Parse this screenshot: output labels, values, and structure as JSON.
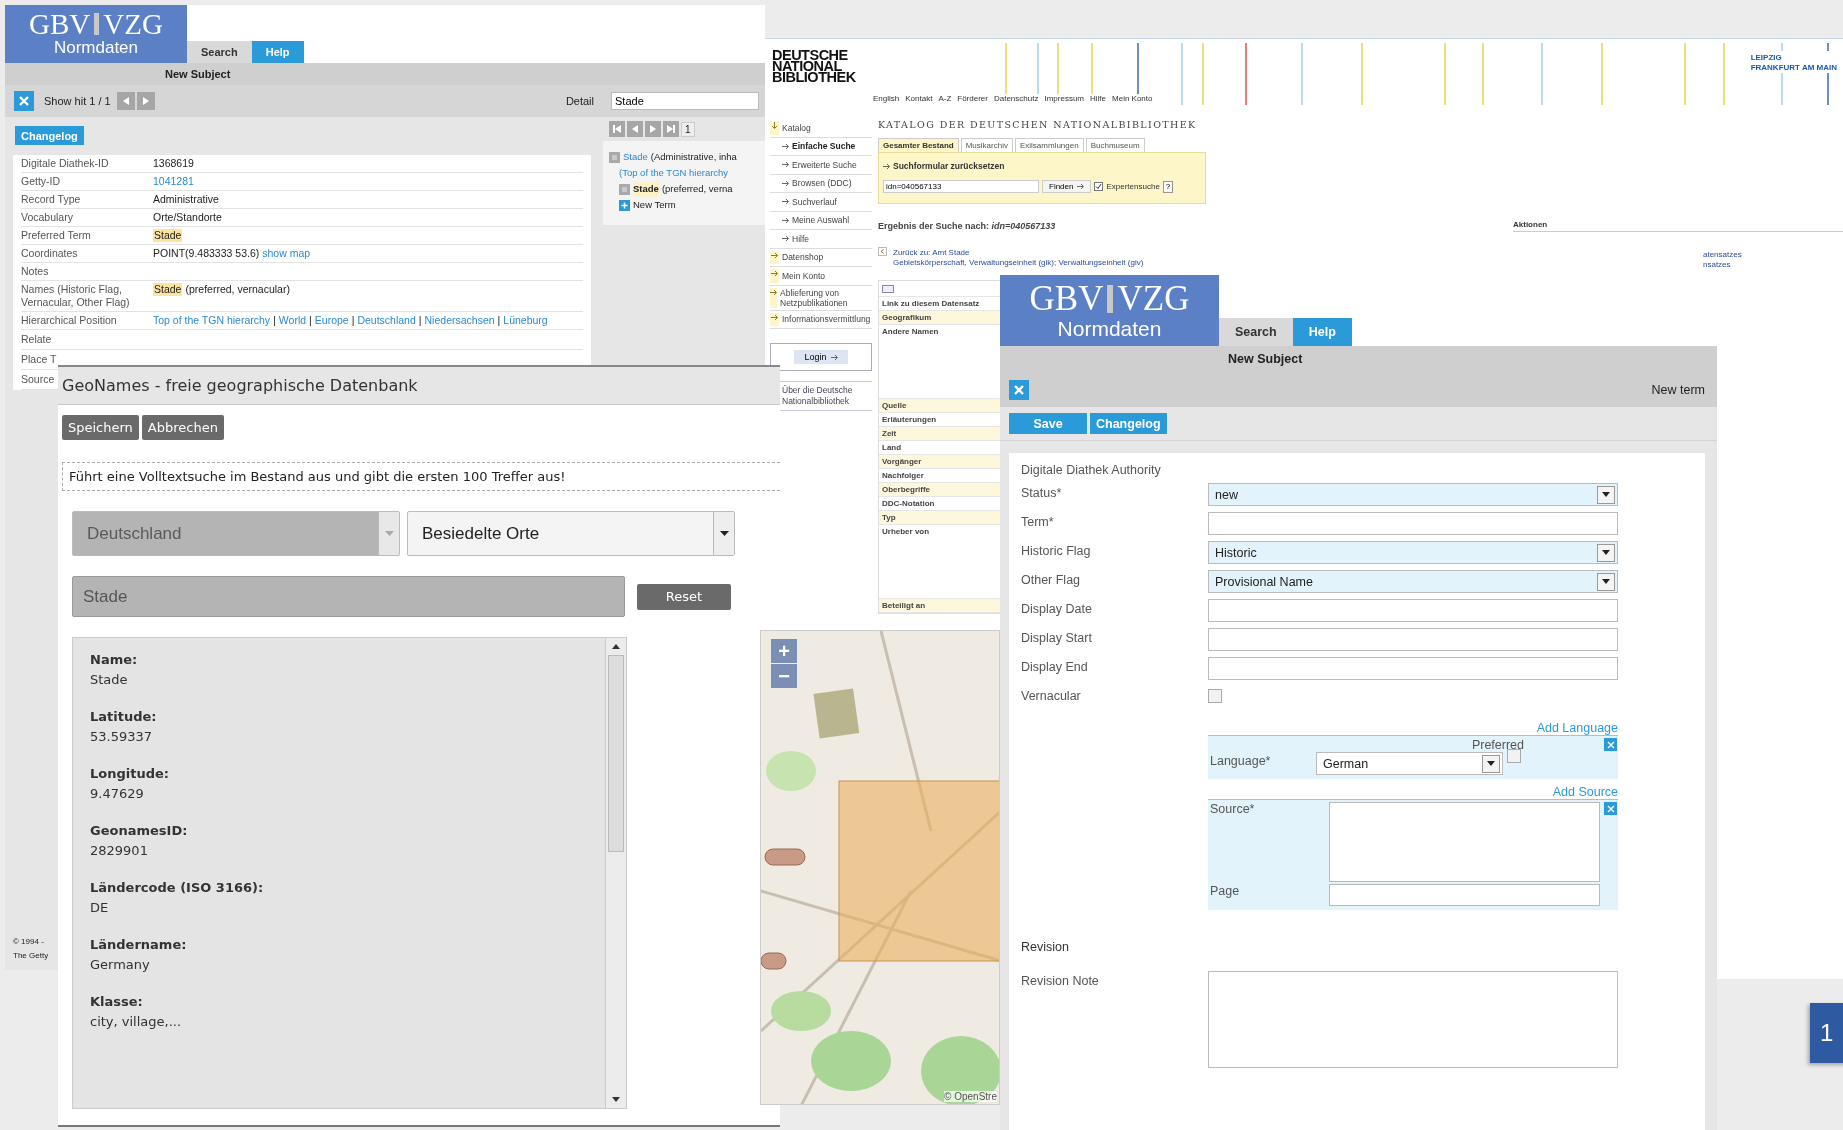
{
  "detail_window": {
    "logo": {
      "left": "GBV",
      "right": "VZG",
      "subtitle": "Normdaten"
    },
    "tabs": [
      {
        "label": "Search",
        "selected": false
      },
      {
        "label": "Help",
        "selected": true
      }
    ],
    "subheading": "New Subject",
    "hit_label": "Show hit 1 / 1",
    "view_label": "Detail",
    "changelog_button": "Changelog",
    "fields": [
      {
        "label": "Digitale Diathek-ID",
        "kind": "text",
        "value": "1368619"
      },
      {
        "label": "Getty-ID",
        "kind": "link",
        "value": "1041281"
      },
      {
        "label": "Record Type",
        "kind": "text",
        "value": "Administrative"
      },
      {
        "label": "Vocabulary",
        "kind": "text",
        "value": "Orte/Standorte"
      },
      {
        "label": "Preferred Term",
        "kind": "highlight",
        "value": "Stade"
      },
      {
        "label": "Coordinates",
        "kind": "point",
        "value": "POINT(9.483333 53.6)",
        "link": "show map"
      },
      {
        "label": "Notes",
        "kind": "text"
      },
      {
        "label": "Names (Historic Flag, Vernacular, Other Flag)",
        "kind": "highlight",
        "value": "Stade",
        "note": "(preferred, vernacular)"
      },
      {
        "label": "Hierarchical Position",
        "kind": "links",
        "separator": "|",
        "links": [
          "Top of the TGN hierarchy",
          "World",
          "Europe",
          "Deutschland",
          "Niedersachsen",
          "Lüneburg"
        ]
      }
    ],
    "covered_rows": [
      "Relate",
      "Place T",
      "Source"
    ],
    "footer": [
      "© 1994 -",
      "The Getty"
    ],
    "search_panel": {
      "query": "Stade",
      "page": "1",
      "tree": [
        {
          "kind": "link_entry",
          "term": "Stade",
          "text": "(Administrative, inha",
          "path": "(Top of the TGN hierarchy",
          "children": [
            {
              "kind": "term_entry",
              "term": "Stade",
              "text": "(preferred, verna"
            },
            {
              "kind": "new",
              "text": "New Term"
            }
          ]
        }
      ]
    }
  },
  "catalog_window": {
    "logo": [
      "DEUTSCHE",
      "NATIONAL",
      "BIBLIOTHEK"
    ],
    "nav": [
      "English",
      "Kontakt",
      "A-Z",
      "Förderer",
      "Datenschutz",
      "Impressum",
      "Hilfe",
      "Mein Konto"
    ],
    "locations": [
      "LEIPZIG",
      "FRANKFURT AM MAIN"
    ],
    "sidebar": [
      {
        "label": "Katalog",
        "expanded": true,
        "children": [
          {
            "label": "Einfache Suche",
            "selected": true
          },
          {
            "label": "Erweiterte Suche",
            "selected": false
          },
          {
            "label": "Browsen (DDC)",
            "selected": false
          },
          {
            "label": "Suchverlauf",
            "selected": false
          },
          {
            "label": "Meine Auswahl",
            "selected": false
          },
          {
            "label": "Hilfe",
            "selected": false
          }
        ]
      },
      {
        "label": "Datenshop",
        "expanded": false
      },
      {
        "label": "Mein Konto",
        "expanded": false
      },
      {
        "label": "Ablieferung von Netzpublikationen",
        "expanded": false
      },
      {
        "label": "Informationsvermittlung",
        "expanded": false
      }
    ],
    "login_button": "Login",
    "about_link": "Über die Deutsche Nationalbibliothek",
    "title": "KATALOG DER DEUTSCHEN NATIONALBIBLIOTHEK",
    "tabs": [
      {
        "label": "Gesamter Bestand",
        "selected": true
      },
      {
        "label": "Musikarchiv",
        "selected": false
      },
      {
        "label": "Exilsammlungen",
        "selected": false
      },
      {
        "label": "Buchmuseum",
        "selected": false
      }
    ],
    "reset_link": "Suchformular zurücksetzen",
    "query": "idn=040567133",
    "find_button": "Finden",
    "expert": {
      "label": "Expertensuche",
      "checked": true
    },
    "help_button": "?",
    "result_heading": "Ergebnis der Suche nach: *idn=040567133*",
    "back": {
      "link": "Zurück zu: Amt Stade",
      "detail": "Gebietskörperschaft, Verwaltungseinheit (gik); Verwaltungseinheit (giv)"
    },
    "record_rows": [
      {
        "label": "Link zu diesem Datensatz",
        "kind": "single"
      },
      {
        "label": "Geografikum",
        "kind": "single"
      },
      {
        "label": "Andere Namen",
        "kind": "tall"
      },
      {
        "label": "Quelle",
        "kind": "single"
      },
      {
        "label": "Erläuterungen",
        "kind": "single"
      },
      {
        "label": "Zeit",
        "kind": "single"
      },
      {
        "label": "Land",
        "kind": "single"
      },
      {
        "label": "Vorgänger",
        "kind": "single"
      },
      {
        "label": "Nachfolger",
        "kind": "single"
      },
      {
        "label": "Oberbegriffe",
        "kind": "single"
      },
      {
        "label": "DDC-Notation",
        "kind": "single"
      },
      {
        "label": "Typ",
        "kind": "single"
      },
      {
        "label": "Urheber von",
        "kind": "tall"
      },
      {
        "label": "Beteiligt an",
        "kind": "single"
      }
    ],
    "actions_heading": "Aktionen",
    "actions_partial": [
      "atensatzes",
      "nsatzes"
    ]
  },
  "geonames_dialog": {
    "title": "GeoNames - freie geographische Datenbank",
    "buttons": [
      "Speichern",
      "Abbrechen"
    ],
    "hint": "Führt eine Volltextsuche im Bestand aus und gibt die ersten 100 Treffer aus!",
    "country_select": {
      "value": "Deutschland",
      "disabled": true
    },
    "class_select": {
      "value": "Besiedelte Orte",
      "disabled": false
    },
    "search": {
      "value": "Stade",
      "disabled": true
    },
    "reset_button": "Reset",
    "details": [
      {
        "label": "Name:",
        "value": "Stade"
      },
      {
        "label": "Latitude:",
        "value": "53.59337"
      },
      {
        "label": "Longitude:",
        "value": "9.47629"
      },
      {
        "label": "GeonamesID:",
        "value": "2829901"
      },
      {
        "label": "Ländercode (ISO 3166):",
        "value": "DE"
      },
      {
        "label": "Ländername:",
        "value": "Germany"
      },
      {
        "label": "Klasse:",
        "value": "city, village,..."
      }
    ],
    "map": {
      "zoom_controls": [
        "+",
        "−"
      ],
      "attribution": "© OpenStre"
    }
  },
  "entry_form": {
    "logo": {
      "left": "GBV",
      "right": "VZG",
      "subtitle": "Normdaten"
    },
    "tabs": [
      {
        "label": "Search",
        "selected": false
      },
      {
        "label": "Help",
        "selected": true
      }
    ],
    "subheading": "New Subject",
    "toolbar_title": "New term",
    "buttons": [
      "Save",
      "Changelog"
    ],
    "section": "Digitale Diathek Authority",
    "fields": [
      {
        "label": "Status*",
        "kind": "select",
        "value": "new"
      },
      {
        "label": "Term*",
        "kind": "input"
      },
      {
        "label": "Historic Flag",
        "kind": "select",
        "value": "Historic"
      },
      {
        "label": "Other Flag",
        "kind": "select",
        "value": "Provisional Name"
      },
      {
        "label": "Display Date",
        "kind": "input"
      },
      {
        "label": "Display Start",
        "kind": "input"
      },
      {
        "label": "Display End",
        "kind": "input"
      },
      {
        "label": "Vernacular",
        "kind": "checkbox",
        "checked": false
      }
    ],
    "add_language": "Add Language",
    "language": {
      "preferred_label": "Preferred",
      "preferred": false,
      "label": "Language*",
      "value": "German"
    },
    "add_source": "Add Source",
    "source": {
      "label": "Source*",
      "page_label": "Page"
    },
    "revision_heading": "Revision",
    "revision_note_label": "Revision Note"
  },
  "page_tile": "1"
}
